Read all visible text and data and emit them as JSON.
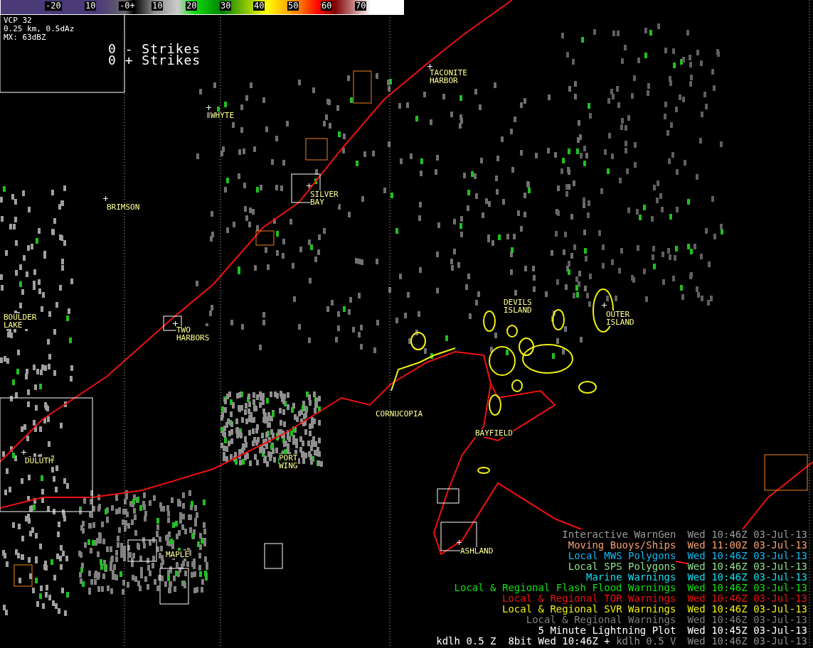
{
  "color_bar": {
    "ticks": [
      "-20",
      "10",
      "-0+",
      "10",
      "20",
      "30",
      "40",
      "50",
      "60",
      "70"
    ]
  },
  "scan_info": [
    "VCP 32",
    "0.25 km, 0.5dAz",
    "MX: 63dBZ"
  ],
  "strikes": [
    "0 - Strikes",
    "0 + Strikes"
  ],
  "towns": [
    {
      "lines": [
        "TACONITE",
        "HARBOR"
      ]
    },
    {
      "lines": [
        "WHYTE"
      ]
    },
    {
      "lines": [
        "SILVER",
        "BAY"
      ]
    },
    {
      "lines": [
        "BRIMSON"
      ]
    },
    {
      "lines": [
        "BOULDER",
        "LAKE"
      ]
    },
    {
      "lines": [
        "TWO",
        "HARBORS"
      ]
    },
    {
      "lines": [
        "DEVILS",
        "ISLAND"
      ]
    },
    {
      "lines": [
        "OUTER",
        "ISLAND"
      ]
    },
    {
      "lines": [
        "CORNUCOPIA"
      ]
    },
    {
      "lines": [
        "BAYFIELD"
      ]
    },
    {
      "lines": [
        "PORT",
        "WING"
      ]
    },
    {
      "lines": [
        "DULUTH"
      ]
    },
    {
      "lines": [
        "MAPLE"
      ]
    },
    {
      "lines": [
        "ASHLAND"
      ]
    }
  ],
  "legend": [
    {
      "label": "Interactive WarnGen",
      "time": "Wed 10:46Z 03-Jul-13",
      "color": "#9a9a9a"
    },
    {
      "label": "Moving Buoys/Ships",
      "time": "Wed 11:00Z 03-Jul-13",
      "color": "#f4a070"
    },
    {
      "label": "Local MWS Polygons",
      "time": "Wed 10:46Z 03-Jul-13",
      "color": "#10b8f0"
    },
    {
      "label": "Local SPS Polygons",
      "time": "Wed 10:46Z 03-Jul-13",
      "color": "#90e090"
    },
    {
      "label": "Marine Warnings",
      "time": "Wed 10:46Z 03-Jul-13",
      "color": "#10e0f0"
    },
    {
      "label": "Local & Regional Flash Flood Warnings",
      "time": "Wed 10:46Z 03-Jul-13",
      "color": "#10e010"
    },
    {
      "label": "Local & Regional TOR Warnings",
      "time": "Wed 10:46Z 03-Jul-13",
      "color": "#f01010"
    },
    {
      "label": "Local & Regional SVR Warnings",
      "time": "Wed 10:46Z 03-Jul-13",
      "color": "#f0f010"
    },
    {
      "label": "Local & Regional Warnings",
      "time": "Wed 10:46Z 03-Jul-13",
      "color": "#808080"
    },
    {
      "label": "5 Minute Lightning Plot",
      "time": "Wed 10:45Z 03-Jul-13",
      "color": "#ffffff"
    }
  ],
  "product": {
    "primary": "kdlh 0.5 Z  8bit Wed 10:46Z +",
    "secondary": "kdlh 0.5 V",
    "time": "Wed 10:46Z 03-Jul-13"
  }
}
